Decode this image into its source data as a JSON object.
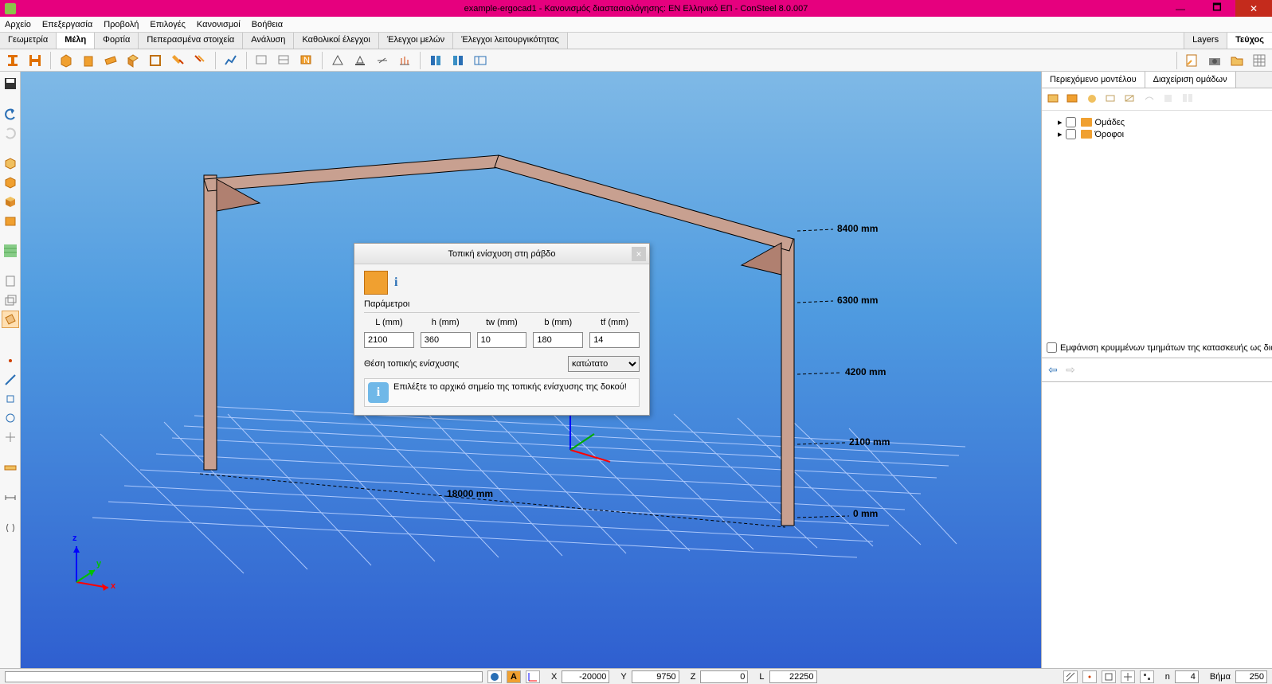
{
  "title": "example-ergocad1 - Κανονισμός διαστασιολόγησης: EN Ελληνικό ΕΠ - ConSteel 8.0.007",
  "menu": [
    "Αρχείο",
    "Επεξεργασία",
    "Προβολή",
    "Επιλογές",
    "Κανονισμοί",
    "Βοήθεια"
  ],
  "tabs": [
    "Γεωμετρία",
    "Μέλη",
    "Φορτία",
    "Πεπερασμένα στοιχεία",
    "Ανάλυση",
    "Καθολικοί έλεγχοι",
    "Έλεγχοι μελών",
    "Έλεγχοι λειτουργικότητας"
  ],
  "tabs_active_index": 1,
  "right_tabs": [
    "Layers",
    "Τεύχος"
  ],
  "right_tabs_active_index": 1,
  "right_panel": {
    "tabs": [
      "Περιεχόμενο μοντέλου",
      "Διαχείριση ομάδων"
    ],
    "tree": [
      "Ομάδες",
      "Όροφοι"
    ],
    "checkbox_label": "Εμφάνιση κρυμμένων τμημάτων της κατασκευής ως διά"
  },
  "dialog": {
    "title": "Τοπική ενίσχυση στη ράβδο",
    "params_label": "Παράμετροι",
    "headers": [
      "L (mm)",
      "h (mm)",
      "tw (mm)",
      "b (mm)",
      "tf (mm)"
    ],
    "values": [
      "2100",
      "360",
      "10",
      "180",
      "14"
    ],
    "position_label": "Θέση τοπικής ενίσχυσης",
    "position_value": "κατώτατο",
    "info_text": "Επιλέξτε το αρχικό σημείο της τοπικής ενίσχυσης της δοκού!"
  },
  "viewport_labels": {
    "d8400": "8400 mm",
    "d6300": "6300 mm",
    "d4200": "4200 mm",
    "d2100": "2100 mm",
    "d0": "0 mm",
    "d18000": "18000 mm",
    "axis_x": "x",
    "axis_y": "y",
    "axis_z": "z"
  },
  "status": {
    "X": "X",
    "Xv": "-20000",
    "Y": "Y",
    "Yv": "9750",
    "Z": "Z",
    "Zv": "0",
    "L": "L",
    "Lv": "22250",
    "n": "n",
    "nv": "4",
    "step": "Βήμα",
    "stepv": "250",
    "A": "A"
  }
}
